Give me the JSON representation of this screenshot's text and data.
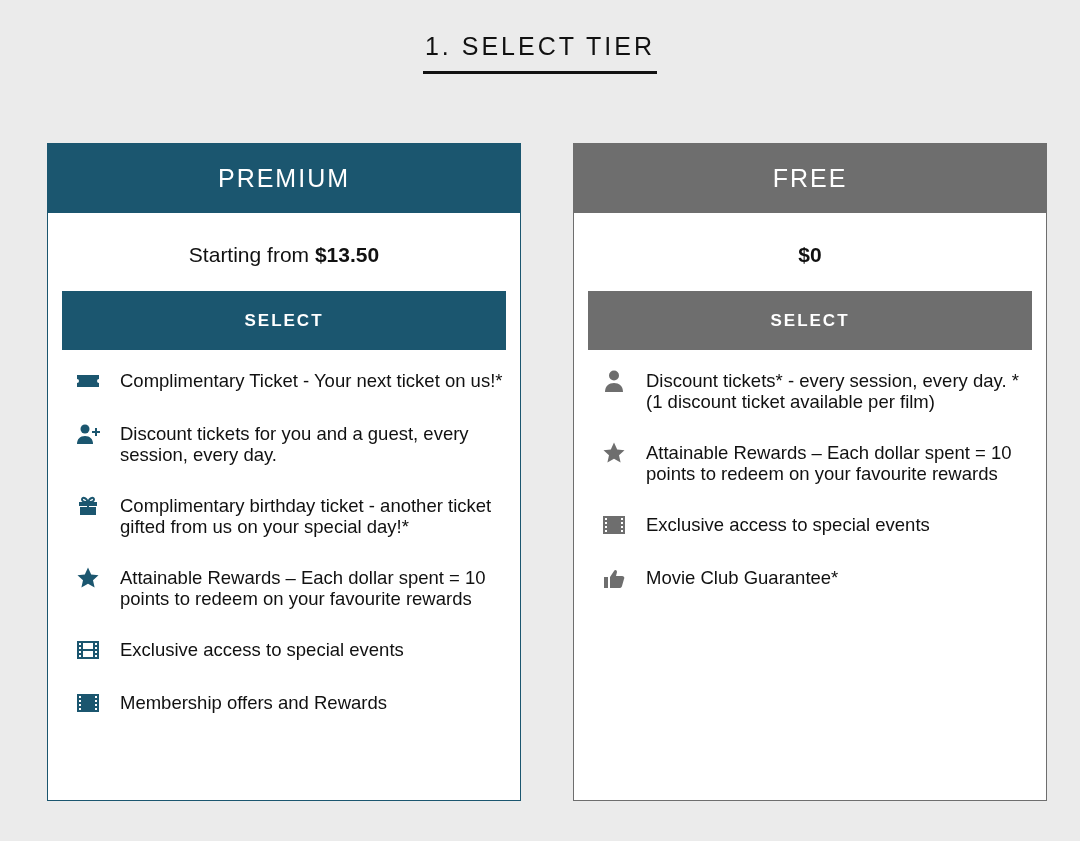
{
  "heading": "1. SELECT TIER",
  "tiers": [
    {
      "name": "PREMIUM",
      "color": "#1b566f",
      "price_prefix": "Starting from",
      "price": "$13.50",
      "button": "SELECT",
      "features": [
        {
          "kind": "ticket",
          "text": "Complimentary Ticket - Your next ticket on us!*"
        },
        {
          "kind": "user-plus",
          "text": "Discount tickets for you and a guest, every session, every day."
        },
        {
          "kind": "gift",
          "text": "Complimentary birthday ticket - another ticket gifted from us on your special day!*"
        },
        {
          "kind": "star",
          "text": "Attainable Rewards – Each dollar spent = 10 points to redeem on your favourite rewards"
        },
        {
          "kind": "film",
          "text": "Exclusive access to special events"
        },
        {
          "kind": "film-solid",
          "text": "Membership offers and Rewards"
        }
      ]
    },
    {
      "name": "FREE",
      "color": "#6e6e6e",
      "price": "$0",
      "button": "SELECT",
      "features": [
        {
          "kind": "user",
          "text": "Discount tickets* - every session, every day. *(1 discount ticket available per film)"
        },
        {
          "kind": "star",
          "text": "Attainable Rewards – Each dollar spent = 10 points to redeem on your favourite rewards"
        },
        {
          "kind": "film-solid",
          "text": "Exclusive access to special events"
        },
        {
          "kind": "thumb",
          "text": "Movie Club Guarantee*"
        }
      ]
    }
  ]
}
